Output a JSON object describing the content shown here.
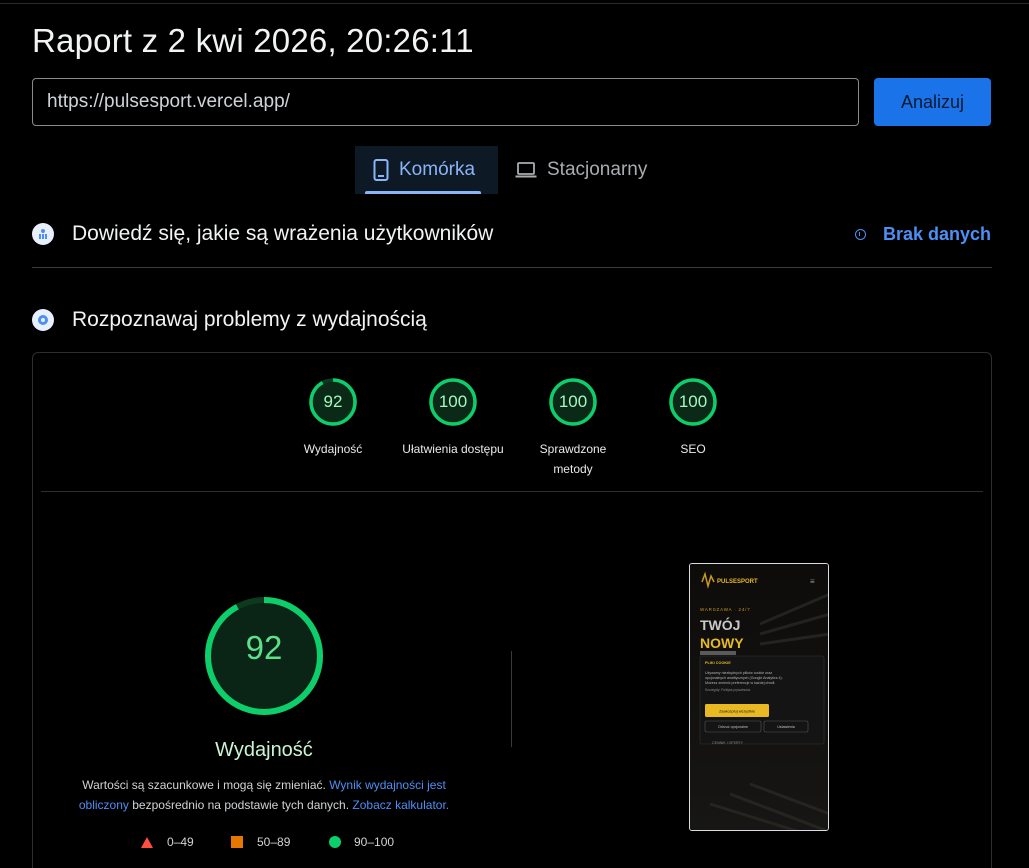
{
  "report": {
    "title": "Raport z 2 kwi 2026, 20:26:11"
  },
  "url_bar": {
    "value": "https://pulsesport.vercel.app/",
    "analyze_label": "Analizuj"
  },
  "device_tabs": {
    "mobile": "Komórka",
    "desktop": "Stacjonarny"
  },
  "field_section": {
    "title": "Dowiedź się, jakie są wrażenia użytkowników",
    "status": "Brak danych"
  },
  "lab_section": {
    "title": "Rozpoznawaj problemy z wydajnością"
  },
  "scores": [
    {
      "value": "92",
      "label": "Wydajność"
    },
    {
      "value": "100",
      "label": "Ułatwienia dostępu"
    },
    {
      "value": "100",
      "label": "Sprawdzone metody"
    },
    {
      "value": "100",
      "label": "SEO"
    }
  ],
  "performance": {
    "score": "92",
    "label": "Wydajność",
    "desc_text_1": "Wartości są szacunkowe i mogą się zmieniać.",
    "desc_link_1": "Wynik wydajności jest obliczony",
    "desc_text_2": "bezpośrednio na podstawie tych danych.",
    "desc_link_2": "Zobacz kalkulator."
  },
  "legend": {
    "poor": "0–49",
    "average": "50–89",
    "good": "90–100"
  },
  "colors": {
    "good": "#0cce6b",
    "average": "#ff9800",
    "poor": "#ff4e42",
    "accent": "#1a73e8"
  },
  "screenshot": {
    "brand": "PULSESPORT",
    "tagline": "WARSZAWA · 24/7",
    "headline_1": "TWÓJ",
    "headline_2": "NOWY",
    "cookie_title": "PLIKI COOKIE",
    "cookie_text": "Używamy niezbędnych plików cookie oraz opcjonalnych analitycznych (Google Analytics 4). Możesz zmienić preferencje w każdej chwili.",
    "cookie_link": "Szczegóły: Polityka prywatności.",
    "accept_label": "Zaakceptuj wszystkie",
    "reject_label": "Odrzuć opcjonalne",
    "settings_label": "Ustawienia",
    "bottom_label": "CENNIK I OFERTY"
  }
}
